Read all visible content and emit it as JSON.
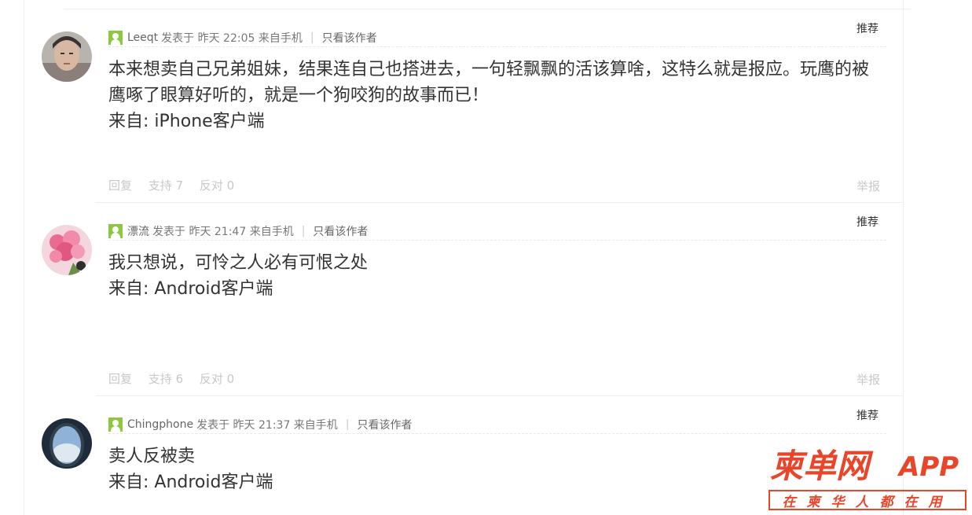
{
  "posts": [
    {
      "author": "Leeqt",
      "posted": "发表于 昨天 22:05 来自手机",
      "only_author": "只看该作者",
      "recommend": "推荐",
      "lines": [
        "本来想卖自己兄弟姐妹，结果连自己也搭进去，一句轻飘飘的活该算啥，这特么就是报应。玩鹰的被",
        "鹰啄了眼算好听的，就是一个狗咬狗的故事而已！",
        "来自: iPhone客户端"
      ],
      "reply": "回复",
      "support": "支持 7",
      "oppose": "反对 0",
      "report": "举报"
    },
    {
      "author": "漂流",
      "posted": "发表于 昨天 21:47 来自手机",
      "only_author": "只看该作者",
      "recommend": "推荐",
      "lines": [
        "我只想说，可怜之人必有可恨之处",
        "来自: Android客户端"
      ],
      "reply": "回复",
      "support": "支持 6",
      "oppose": "反对 0",
      "report": "举报"
    },
    {
      "author": "Chingphone",
      "posted": "发表于 昨天 21:37 来自手机",
      "only_author": "只看该作者",
      "recommend": "推荐",
      "lines": [
        "卖人反被卖",
        "来自: Android客户端"
      ]
    }
  ],
  "logo": {
    "main": "柬单网",
    "app": "APP",
    "tagline": "在柬华人都在用"
  },
  "colors": {
    "brand": "#e8452a",
    "user_icon": "#8dc63f",
    "muted": "#c8c8c8",
    "text": "#333333"
  }
}
